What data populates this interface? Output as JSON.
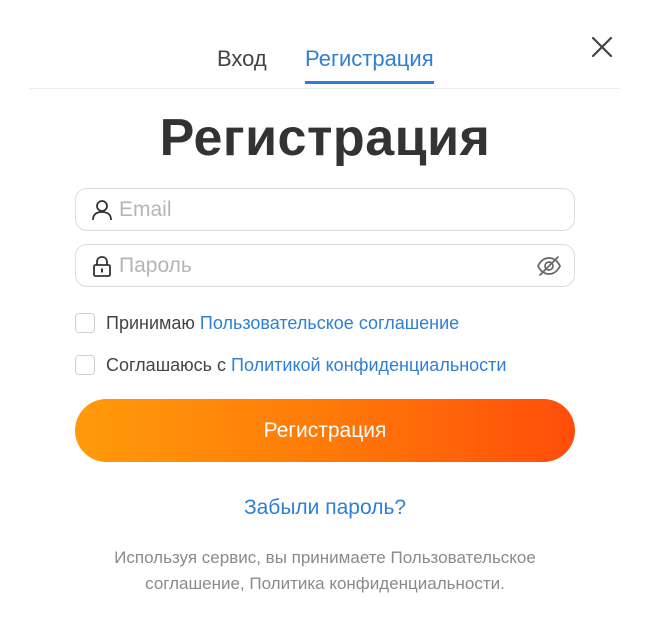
{
  "tabs": [
    {
      "label": "Вход",
      "active": false
    },
    {
      "label": "Регистрация",
      "active": true
    }
  ],
  "heading": "Регистрация",
  "form": {
    "email": {
      "placeholder": "Email",
      "icon": "user-icon"
    },
    "password": {
      "placeholder": "Пароль",
      "icon": "lock-icon",
      "toggle_icon": "eye-off-icon"
    },
    "agreements": [
      {
        "prefix": "Принимаю",
        "link": "Пользовательское соглашение",
        "checked": false
      },
      {
        "prefix": "Соглашаюсь с",
        "link": "Политикой конфиденциальности",
        "checked": false
      }
    ],
    "submit_label": "Регистрация",
    "forgot_label": "Забыли пароль?"
  },
  "footnote": {
    "line1": "Используя сервис, вы принимаете Пользовательское",
    "line2": "соглашение, Политика конфиденциальности."
  },
  "colors": {
    "accent": "#2f7fd4",
    "button_gradient_start": "#ff9a0a",
    "button_gradient_end": "#ff4d0a"
  }
}
